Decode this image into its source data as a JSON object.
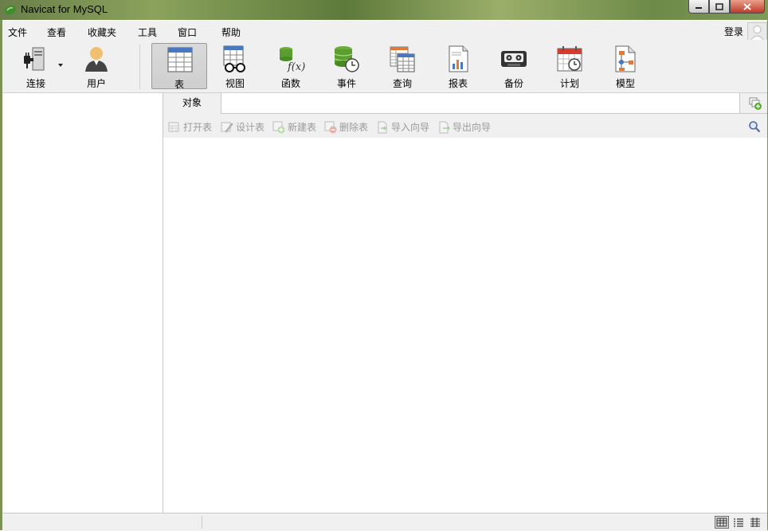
{
  "window": {
    "title": "Navicat for MySQL"
  },
  "menu": {
    "items": [
      "文件",
      "查看",
      "收藏夹",
      "工具",
      "窗口",
      "帮助"
    ],
    "login": "登录"
  },
  "toolbar": {
    "connect": "连接",
    "user": "用户",
    "table": "表",
    "view": "视图",
    "function": "函数",
    "event": "事件",
    "query": "查询",
    "report": "报表",
    "backup": "备份",
    "schedule": "计划",
    "model": "模型",
    "active": "表"
  },
  "tabs": {
    "object": "对象"
  },
  "object_toolbar": {
    "open_table": "打开表",
    "design_table": "设计表",
    "new_table": "新建表",
    "delete_table": "删除表",
    "import_wizard": "导入向导",
    "export_wizard": "导出向导"
  },
  "colors": {
    "accent_green": "#5a9e2f",
    "title_bg": "#7b9456"
  }
}
